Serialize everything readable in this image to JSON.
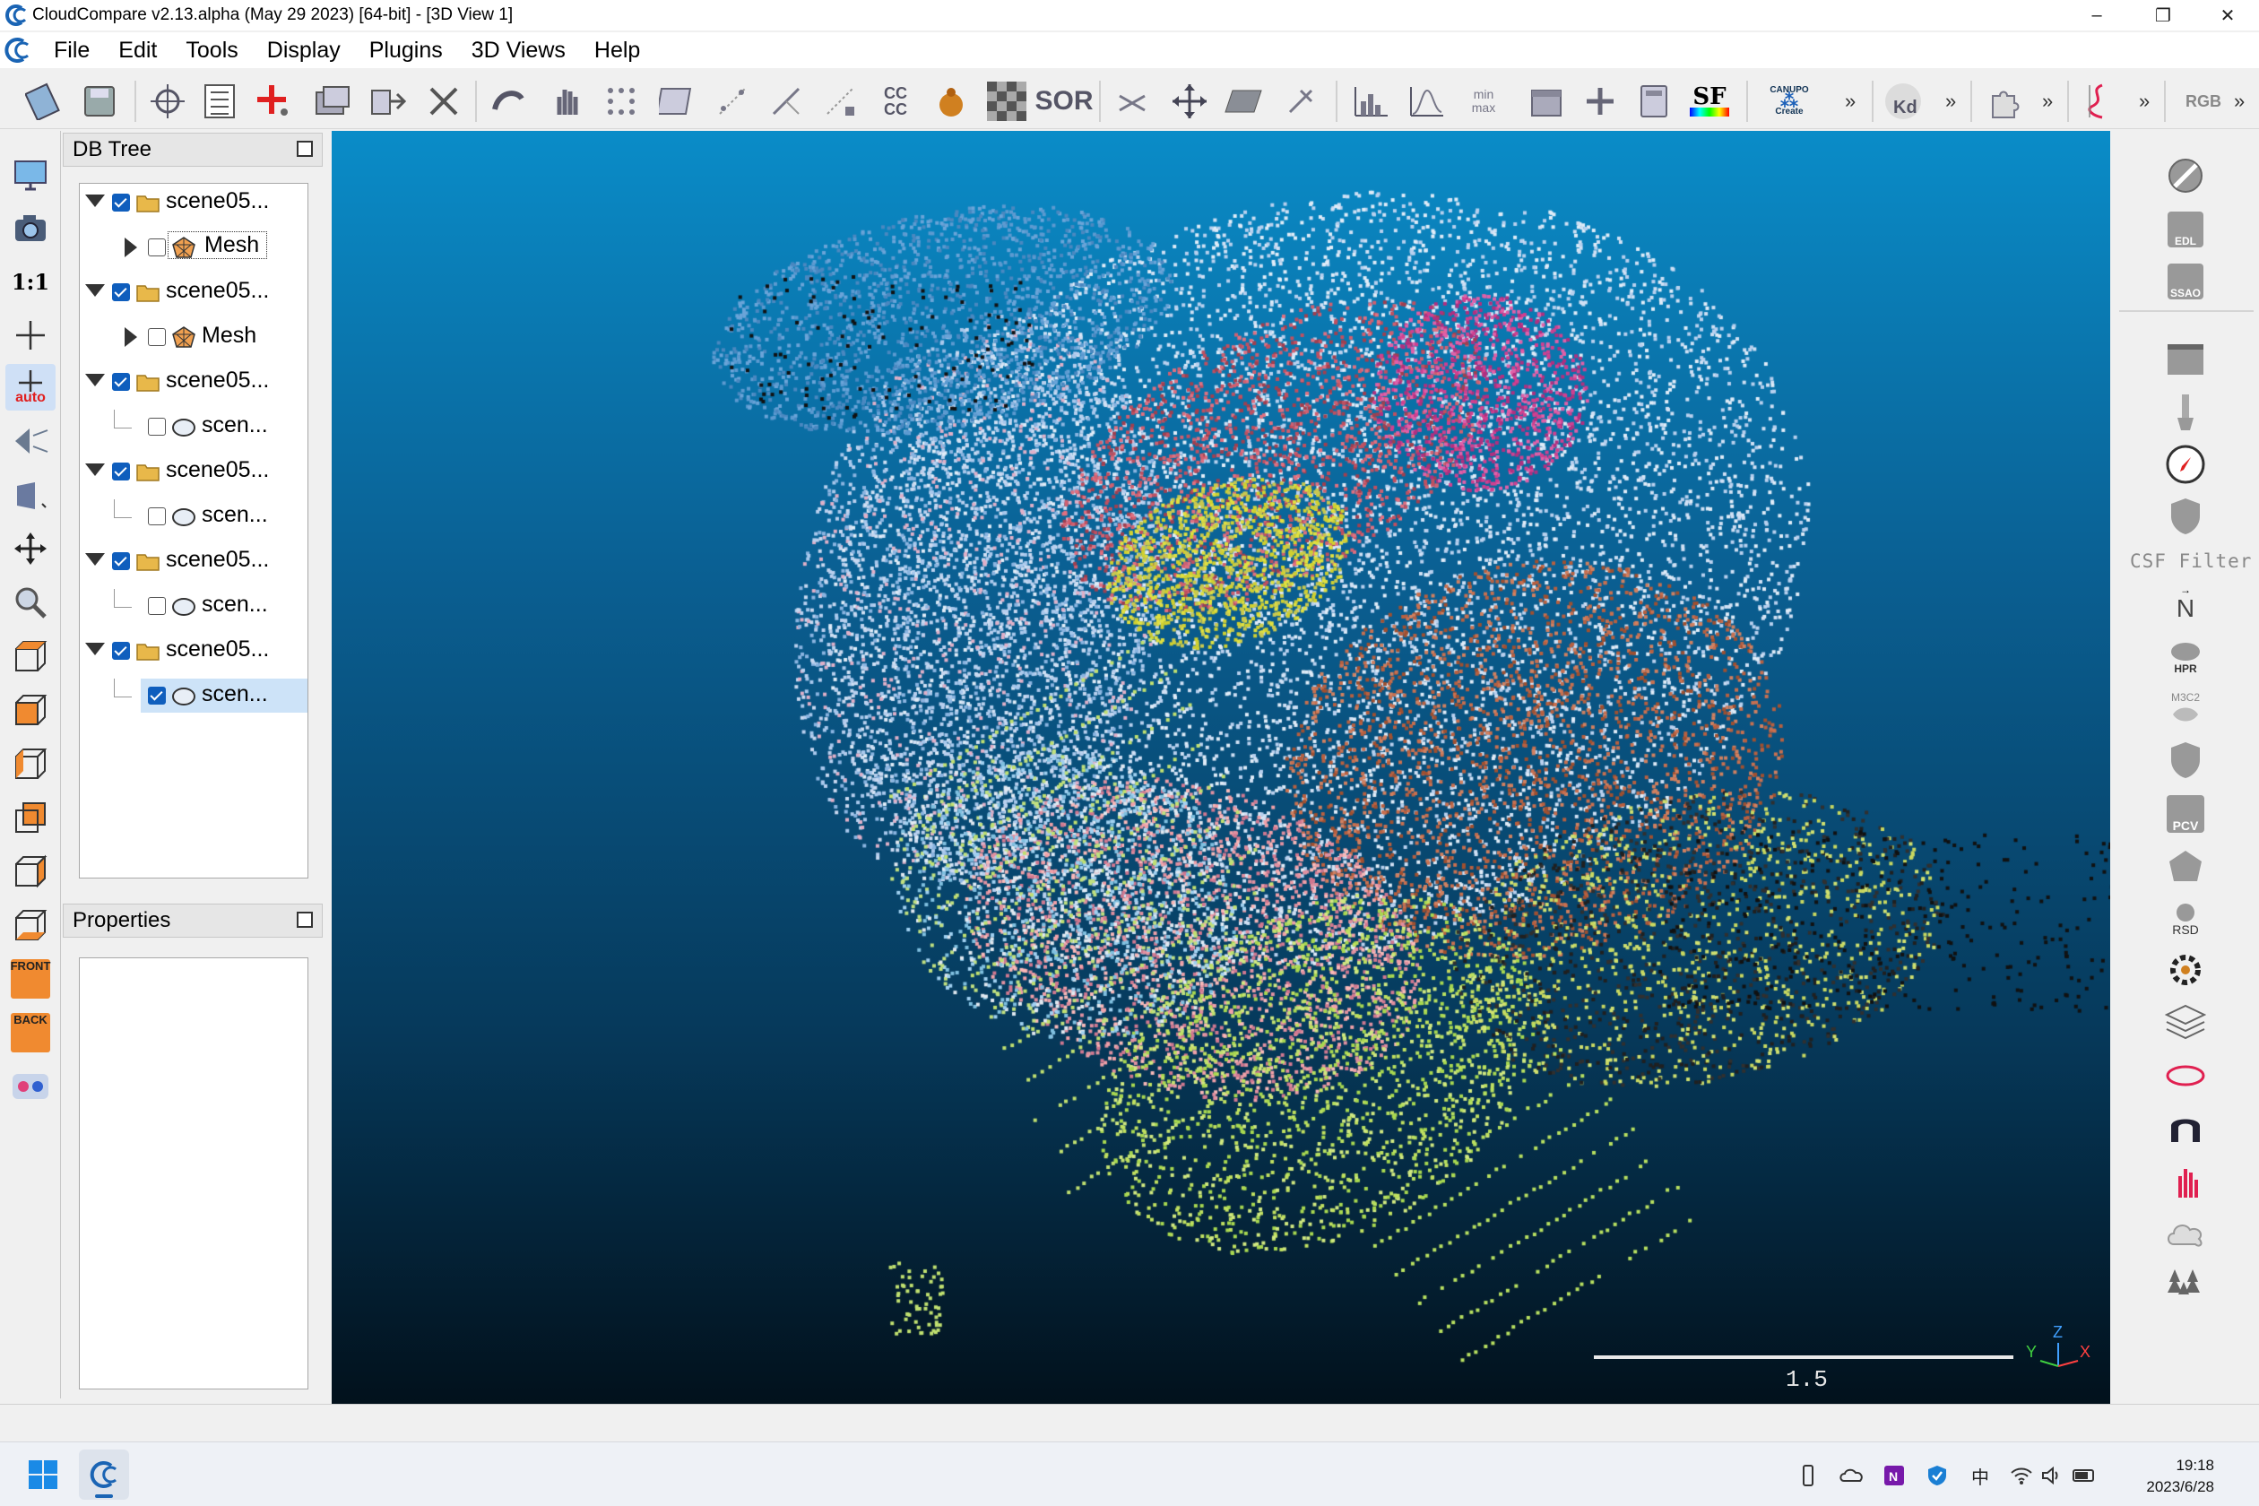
{
  "window": {
    "title": "CloudCompare v2.13.alpha (May 29 2023) [64-bit] - [3D View 1]",
    "minimize": "–",
    "maximize": "❐",
    "close": "✕"
  },
  "menu": [
    "File",
    "Edit",
    "Tools",
    "Display",
    "Plugins",
    "3D Views",
    "Help"
  ],
  "panels": {
    "db_tree_title": "DB Tree",
    "properties_title": "Properties"
  },
  "db_tree": [
    {
      "label": "scene05...",
      "level": 0,
      "expanded": true,
      "checked": true,
      "type": "group"
    },
    {
      "label": "Mesh",
      "level": 1,
      "expanded": false,
      "checked": false,
      "type": "mesh",
      "selected": true
    },
    {
      "label": "scene05...",
      "level": 0,
      "expanded": true,
      "checked": true,
      "type": "group"
    },
    {
      "label": "Mesh",
      "level": 1,
      "expanded": false,
      "checked": false,
      "type": "mesh"
    },
    {
      "label": "scene05...",
      "level": 0,
      "expanded": true,
      "checked": true,
      "type": "group"
    },
    {
      "label": "scen...",
      "level": 1,
      "checked": false,
      "type": "cloud"
    },
    {
      "label": "scene05...",
      "level": 0,
      "expanded": true,
      "checked": true,
      "type": "group"
    },
    {
      "label": "scen...",
      "level": 1,
      "checked": false,
      "type": "cloud"
    },
    {
      "label": "scene05...",
      "level": 0,
      "expanded": true,
      "checked": true,
      "type": "group"
    },
    {
      "label": "scen...",
      "level": 1,
      "checked": false,
      "type": "cloud"
    },
    {
      "label": "scene05...",
      "level": 0,
      "expanded": true,
      "checked": true,
      "type": "group"
    },
    {
      "label": "scen...",
      "level": 1,
      "checked": true,
      "type": "cloud",
      "highlight": true
    }
  ],
  "view": {
    "scale_label": "1.5",
    "axis_labels": {
      "y": "Y",
      "z": "Z",
      "x": "X"
    }
  },
  "toolbar": {
    "text_icons": {
      "sor": "SOR",
      "sf": "SF",
      "kd": "Kd",
      "cc": "CC CC",
      "minmax": "min max",
      "canupo": "CANUPO",
      "canupo_create": "Create",
      "rgb": "RGB",
      "more": "»"
    }
  },
  "left_toolbar": {
    "ratio_label": "1:1",
    "auto_label": "auto",
    "front_label": "FRONT",
    "back_label": "BACK"
  },
  "right_toolbar": {
    "csf_filter_label": "CSF Filter",
    "edl": "EDL",
    "ssao": "SSAO",
    "north": "N",
    "hpr": "HPR",
    "m3c2": "M3C2",
    "pcv": "PCV",
    "rsd": "RSD"
  },
  "taskbar": {
    "time": "19:18",
    "date": "2023/6/28",
    "ime": "中"
  },
  "colors": {
    "view_top": "#0a8cc8",
    "view_bottom": "#02111c",
    "checkbox_on": "#0f5ebd"
  }
}
